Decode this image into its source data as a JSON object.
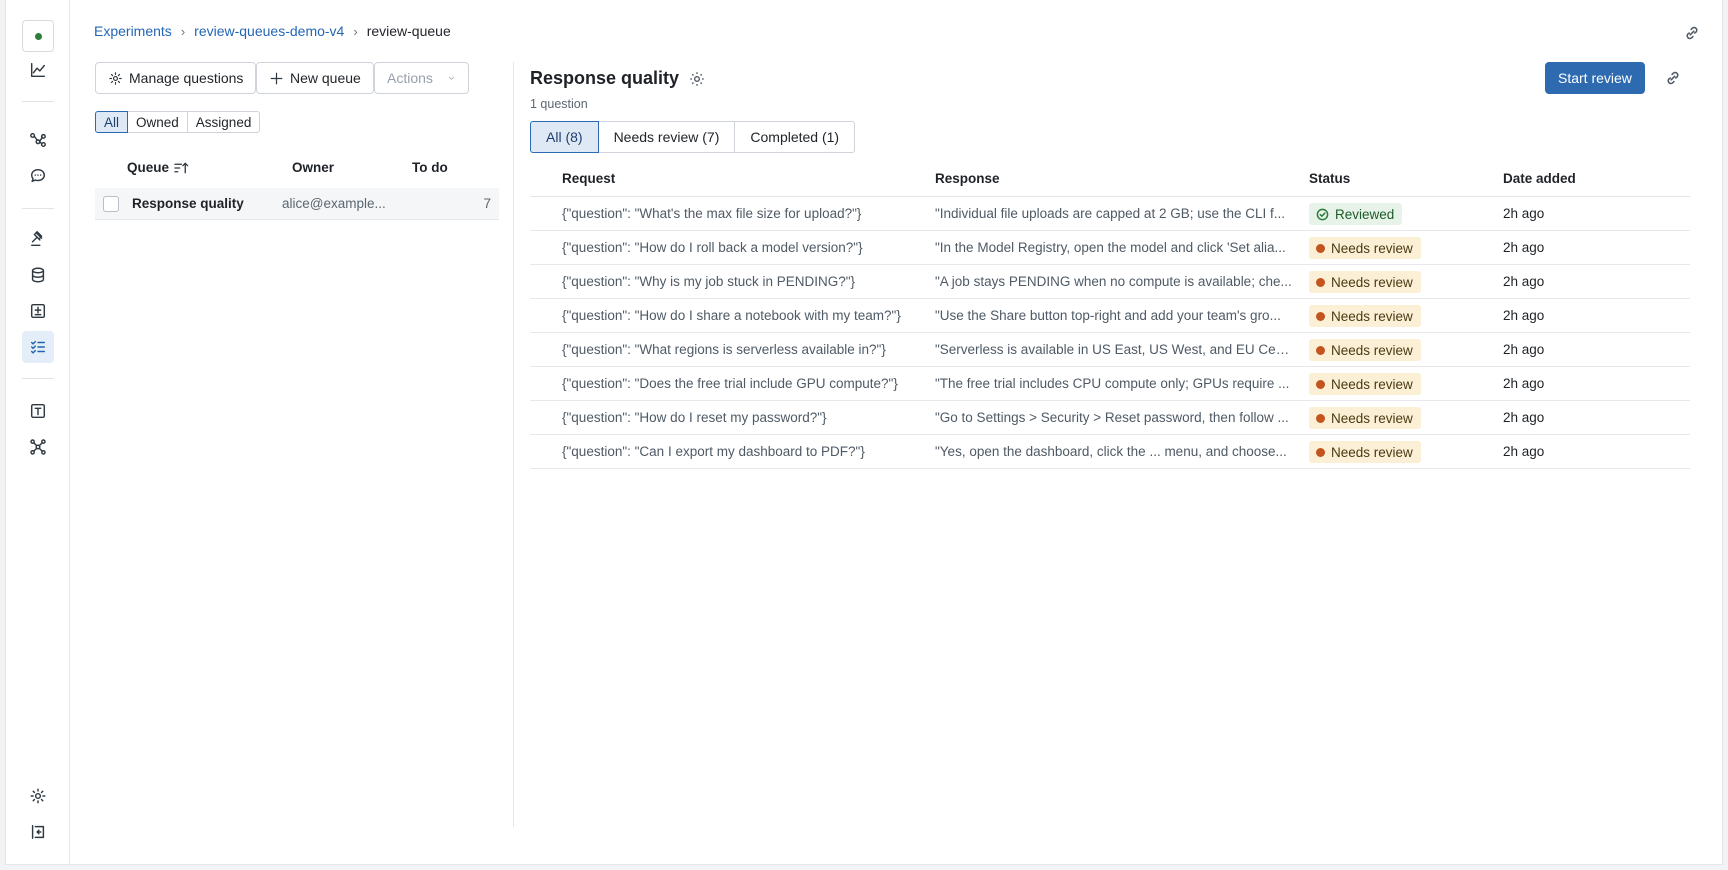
{
  "breadcrumb": {
    "root": "Experiments",
    "experiment": "review-queues-demo-v4",
    "current": "review-queue"
  },
  "toolbar": {
    "manage_questions": "Manage questions",
    "new_queue": "New queue",
    "actions": "Actions"
  },
  "queue_filters": [
    {
      "label": "All",
      "selected": true
    },
    {
      "label": "Owned",
      "selected": false
    },
    {
      "label": "Assigned",
      "selected": false
    }
  ],
  "queue_table": {
    "columns": {
      "queue": "Queue",
      "owner": "Owner",
      "todo": "To do"
    },
    "rows": [
      {
        "name": "Response quality",
        "owner": "alice@example...",
        "todo": "7"
      }
    ]
  },
  "detail": {
    "title": "Response quality",
    "subtitle": "1 question",
    "start_review": "Start review",
    "tabs": [
      {
        "label": "All (8)",
        "selected": true
      },
      {
        "label": "Needs review (7)",
        "selected": false
      },
      {
        "label": "Completed (1)",
        "selected": false
      }
    ],
    "columns": {
      "request": "Request",
      "response": "Response",
      "status": "Status",
      "date": "Date added"
    },
    "rows": [
      {
        "request": "{\"question\": \"What's the max file size for upload?\"}",
        "response": "\"Individual file uploads are capped at 2 GB; use the CLI f...",
        "status": "Reviewed",
        "date": "2h ago"
      },
      {
        "request": "{\"question\": \"How do I roll back a model version?\"}",
        "response": "\"In the Model Registry, open the model and click 'Set alia...",
        "status": "Needs review",
        "date": "2h ago"
      },
      {
        "request": "{\"question\": \"Why is my job stuck in PENDING?\"}",
        "response": "\"A job stays PENDING when no compute is available; che...",
        "status": "Needs review",
        "date": "2h ago"
      },
      {
        "request": "{\"question\": \"How do I share a notebook with my team?\"}",
        "response": "\"Use the Share button top-right and add your team's gro...",
        "status": "Needs review",
        "date": "2h ago"
      },
      {
        "request": "{\"question\": \"What regions is serverless available in?\"}",
        "response": "\"Serverless is available in US East, US West, and EU Cent...",
        "status": "Needs review",
        "date": "2h ago"
      },
      {
        "request": "{\"question\": \"Does the free trial include GPU compute?\"}",
        "response": "\"The free trial includes CPU compute only; GPUs require ...",
        "status": "Needs review",
        "date": "2h ago"
      },
      {
        "request": "{\"question\": \"How do I reset my password?\"}",
        "response": "\"Go to Settings > Security > Reset password, then follow ...",
        "status": "Needs review",
        "date": "2h ago"
      },
      {
        "request": "{\"question\": \"Can I export my dashboard to PDF?\"}",
        "response": "\"Yes, open the dashboard, click the ... menu, and choose...",
        "status": "Needs review",
        "date": "2h ago"
      }
    ]
  },
  "colors": {
    "accent": "#2d6ab0",
    "reviewed_bg": "#e7f3e8",
    "needs_review_bg": "#fbf0d6",
    "needs_review_dot": "#c4541f",
    "logo_dot": "#2e7d3a"
  },
  "rail_icons": [
    "workspace-logo-icon",
    "chart-icon",
    "trace-graph-icon",
    "chat-icon",
    "judge-gavel-icon",
    "database-icon",
    "evaluation-icon",
    "review-checklist-icon",
    "prompt-text-icon",
    "model-network-icon",
    "settings-gear-icon",
    "collapse-sidebar-icon"
  ]
}
